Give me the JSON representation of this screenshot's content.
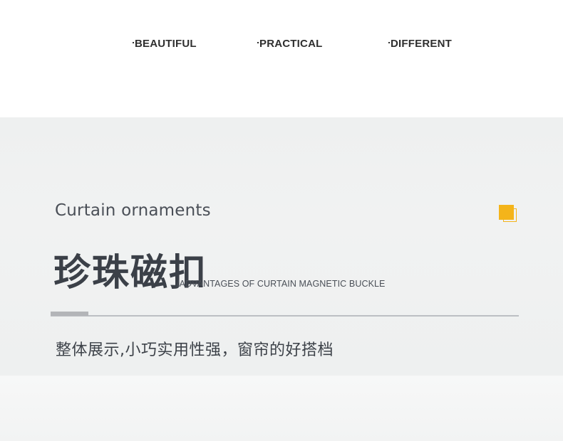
{
  "keywords": {
    "k1": "BEAUTIFUL",
    "k2": "PRACTICAL",
    "k3": "DIFFERENT"
  },
  "feature": {
    "subtitle_en": "Curtain ornaments",
    "title_cn": "珍珠磁扣",
    "title_en": "/ADVANTAGES OF CURTAIN MAGNETIC BUCKLE",
    "description": "整体展示,小巧实用性强，窗帘的好搭档"
  },
  "icons": {
    "square": "double-square-icon"
  },
  "colors": {
    "accent": "#f4b41a",
    "text_dark": "#3b4048",
    "band_bg": "#eff0f0"
  }
}
